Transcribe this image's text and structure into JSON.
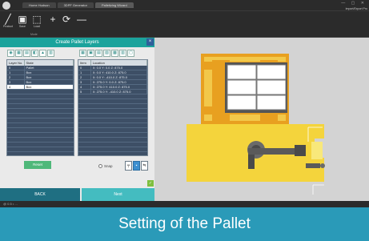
{
  "titlebar": {
    "tabs": [
      "Home Hudson",
      "3DPF Generator",
      "Palletizing Wizard"
    ],
    "window_controls": "— ▢ ✕",
    "user_text": "Import/Export  Pro"
  },
  "toolbar": {
    "buttons": [
      {
        "label": "Product",
        "icon": "pencil-icon",
        "glyph": "╱"
      },
      {
        "label": "Save",
        "icon": "folder-icon",
        "glyph": "▣"
      },
      {
        "label": "Load",
        "icon": "window-icon",
        "glyph": "⬚"
      },
      {
        "label": "",
        "icon": "plus-icon",
        "glyph": "+"
      },
      {
        "label": "",
        "icon": "rotate-icon",
        "glyph": "⟳"
      },
      {
        "label": "",
        "icon": "minus-icon",
        "glyph": "—"
      }
    ],
    "group_label": "Mode"
  },
  "dialog": {
    "title": "Create Pallet Layers",
    "close": "×",
    "layers_headers": [
      "Layer No.",
      "State"
    ],
    "layers": [
      [
        "0",
        "Pallet"
      ],
      [
        "1",
        "Box"
      ],
      [
        "2",
        "Box"
      ],
      [
        "3",
        "Box"
      ],
      [
        "4",
        "Box"
      ]
    ],
    "selected_layer": 4,
    "items_headers": [
      "Item",
      "Location"
    ],
    "items": [
      [
        "0",
        "X: 0.0   Y: 0.0   Z: 875.0"
      ],
      [
        "1",
        "X: 0.0   Y: 410.0   Z: 875.0"
      ],
      [
        "2",
        "X: 0.0   Y: -410.0   Z: 875.0"
      ],
      [
        "3",
        "X: 275.0   Y: 0.0   Z: 875.0"
      ],
      [
        "4",
        "X: 275.0   Y: 410.0   Z: 875.0"
      ],
      [
        "5",
        "X: 275.0   Y: -410.0   Z: 875.0"
      ]
    ],
    "reset_label": "Reset",
    "snap_label": "Snap",
    "back_label": "BACK",
    "next_label": "Next"
  },
  "statusbar": {
    "text": "@ 0.5 • ..."
  },
  "caption": "Setting of the Pallet",
  "colors": {
    "accent": "#1ba39c",
    "pallet_yellow": "#f4d43c",
    "pallet_orange": "#e8a020",
    "caption_bg": "#2a9ab8"
  }
}
